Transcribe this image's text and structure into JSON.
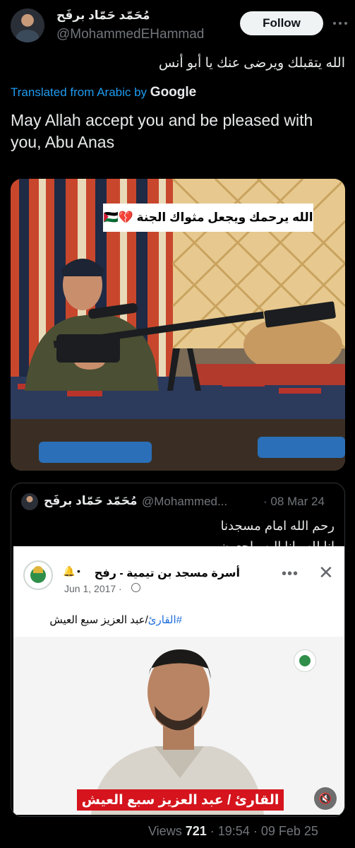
{
  "author": {
    "display_name": "مُحَمّد حَمّاد برفَح",
    "handle": "@MohammedEHammad",
    "follow_label": "Follow"
  },
  "tweet": {
    "text_arabic": "الله يتقبلك ويرضى عنك يا أبو أنس",
    "translated_label": "Translated from Arabic by",
    "translated_brand": "Google",
    "text_english": "May Allah accept you and be pleased with you, Abu Anas"
  },
  "photo": {
    "overlay_text": "الله يرحمك ويجعل مثواك الجنة 💔🇵🇸"
  },
  "quoted": {
    "display_name": "مُحَمّد حَمّاد برفَح",
    "handle": "@Mohammed...",
    "date": "· 08 Mar 24",
    "line1": "رحم الله امام مسجدنا",
    "line2": "إنا لله وإنا إليه راجعون",
    "fb": {
      "page_name": "أسرة مسجد بن تيمية - رفح",
      "bell": "🔔",
      "dot": "•",
      "date": "Jun 1, 2017 ·",
      "more": "•••",
      "close": "✕",
      "caption_tag": "#القارئ",
      "caption_text": "/عبد العزيز سبع العيش",
      "banner": "القارئ / عبد العزيز سبع العيش",
      "mute": "🔇"
    }
  },
  "footer": {
    "views_label": "Views",
    "views_count": "721",
    "time": "· 19:54 · 09 Feb 25"
  },
  "colors": {
    "background": "#000000",
    "link_blue": "#1d9bf0",
    "muted": "#71767b",
    "banner_red": "#d5141d"
  }
}
